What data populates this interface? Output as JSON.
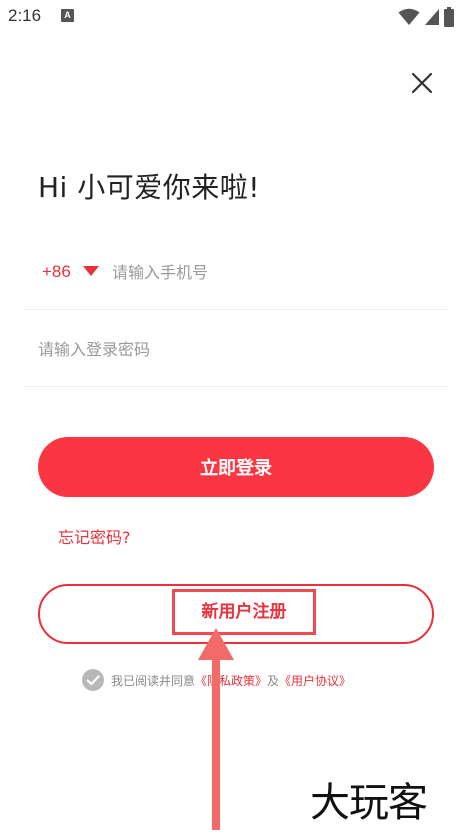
{
  "status_bar": {
    "time": "2:16",
    "notification_badge": "A",
    "icons": [
      "wifi-icon",
      "signal-icon",
      "battery-icon"
    ]
  },
  "close_icon": "close-icon",
  "greeting": "Hi 小可爱你来啦!",
  "phone": {
    "country_code": "+86",
    "placeholder": "请输入手机号"
  },
  "password": {
    "placeholder": "请输入登录密码"
  },
  "login_label": "立即登录",
  "forgot_label": "忘记密码?",
  "register_label": "新用户注册",
  "agreement": {
    "checked": true,
    "prefix": "我已阅读并同意",
    "privacy_link": "《隐私政策》",
    "joiner": "及",
    "terms_link": "《用户协议》"
  },
  "watermark": "大玩客",
  "colors": {
    "accent": "#fb3643",
    "accent_text": "#e8323c",
    "annotation": "#f04b53"
  }
}
